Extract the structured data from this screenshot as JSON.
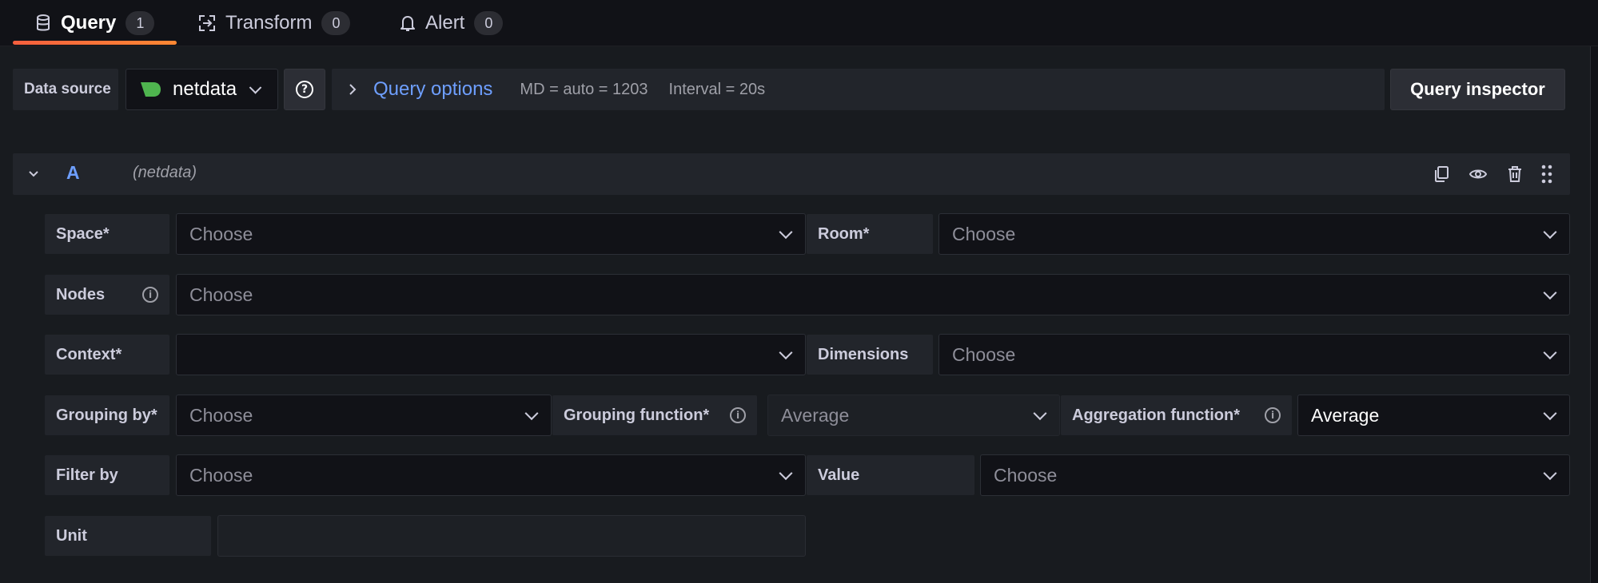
{
  "tabs": [
    {
      "label": "Query",
      "count": "1"
    },
    {
      "label": "Transform",
      "count": "0"
    },
    {
      "label": "Alert",
      "count": "0"
    }
  ],
  "toolbar": {
    "datasource_label": "Data source",
    "datasource_value": "netdata",
    "query_options_label": "Query options",
    "md": "MD = auto = 1203",
    "interval": "Interval = 20s",
    "inspector_label": "Query inspector"
  },
  "query": {
    "ref_id": "A",
    "datasource": "(netdata)"
  },
  "fields": {
    "space": {
      "label": "Space*",
      "placeholder": "Choose"
    },
    "room": {
      "label": "Room*",
      "placeholder": "Choose"
    },
    "nodes": {
      "label": "Nodes",
      "placeholder": "Choose"
    },
    "context": {
      "label": "Context*",
      "placeholder": ""
    },
    "dimensions": {
      "label": "Dimensions",
      "placeholder": "Choose"
    },
    "grouping_by": {
      "label": "Grouping by*",
      "placeholder": "Choose"
    },
    "grouping_function": {
      "label": "Grouping function*",
      "value": "Average"
    },
    "aggregation_function": {
      "label": "Aggregation function*",
      "value": "Average"
    },
    "filter_by": {
      "label": "Filter by",
      "placeholder": "Choose"
    },
    "value": {
      "label": "Value",
      "placeholder": "Choose"
    },
    "unit": {
      "label": "Unit",
      "value": ""
    }
  },
  "colors": {
    "accent_link": "#6e9fff",
    "tab_underline": "#f55f3e",
    "netdata_logo": "#4fb54f"
  }
}
